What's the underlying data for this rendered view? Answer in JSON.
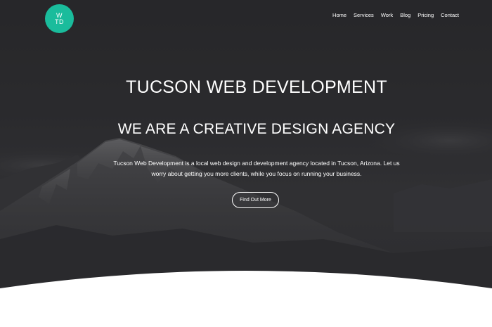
{
  "brand": {
    "logo_line1": "W",
    "logo_line2": "TD",
    "accent_color": "#1abc9c"
  },
  "nav": {
    "items": [
      {
        "label": "Home"
      },
      {
        "label": "Services"
      },
      {
        "label": "Work"
      },
      {
        "label": "Blog"
      },
      {
        "label": "Pricing"
      },
      {
        "label": "Contact"
      }
    ]
  },
  "hero": {
    "title": "TUCSON WEB DEVELOPMENT",
    "subtitle": "WE ARE A CREATIVE DESIGN AGENCY",
    "description_line1": "Tucson Web Development is a local web design and development agency located in Tucson, Arizona. Let us",
    "description_line2": "worry about getting you more clients, while you focus on running your business.",
    "cta_label": "Find Out More",
    "background_image": "mountain-landscape"
  }
}
